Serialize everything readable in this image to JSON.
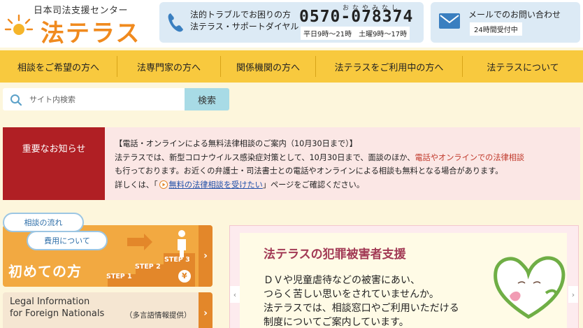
{
  "header": {
    "logo_sub": "日本司法支援センター",
    "logo_main": "法テラス",
    "phone": {
      "label_line1": "法的トラブルでお困りの方",
      "label_line2": "法テラス・サポートダイヤル",
      "ruby": "おなやみなし",
      "number": "0570-078374",
      "hours": "平日9時～21時　土曜9時～17時"
    },
    "mail": {
      "label": "メールでのお問い合わせ",
      "hours": "24時間受付中"
    }
  },
  "nav": {
    "items": [
      {
        "label": "相談をご希望の方へ"
      },
      {
        "label": "法専門家の方へ"
      },
      {
        "label": "関係機関の方へ"
      },
      {
        "label": "法テラスをご利用中の方へ"
      },
      {
        "label": "法テラスについて"
      }
    ]
  },
  "search": {
    "placeholder": "サイト内検索",
    "button_label": "検索"
  },
  "notice": {
    "label": "重要なお知らせ",
    "heading": "【電話・オンラインによる無料法律相談のご案内（10月30日まで）】",
    "line2_pre": "法テラスでは、新型コロナウイルス感染症対策として、10月30日まで、面談のほか、",
    "line2_highlight": "電話やオンラインでの法律相談",
    "line3": "も行っております。お近くの弁護士・司法書士との電話やオンラインによる相談も無料となる場合があります。",
    "line4_pre": "詳しくは、「",
    "link": "無料の法律相談を受けたい",
    "line4_post": "」ページをご確認ください。"
  },
  "cards": {
    "beginner": {
      "bubble_flow": "相談の流れ",
      "bubble_fee": "費用について",
      "title": "初めての方",
      "step1": "STEP 1",
      "step2": "STEP 2",
      "step3": "STEP 3",
      "yen": "¥"
    },
    "foreign": {
      "line1": "Legal Information",
      "line2": "for Foreign Nationals",
      "note": "（多言語情報提供）"
    }
  },
  "banner": {
    "title": "法テラスの犯罪被害者支援",
    "lines": [
      "ＤＶや児童虐待などの被害にあい、",
      "つらく苦しい思いをされていませんか。",
      "法テラスでは、相談窓口やご利用いただける",
      "制度についてご案内しています。"
    ]
  },
  "colors": {
    "brand_orange": "#f08a1e",
    "nav_yellow": "#f8c93e",
    "notice_red": "#b01f24",
    "banner_title": "#a23a55"
  }
}
